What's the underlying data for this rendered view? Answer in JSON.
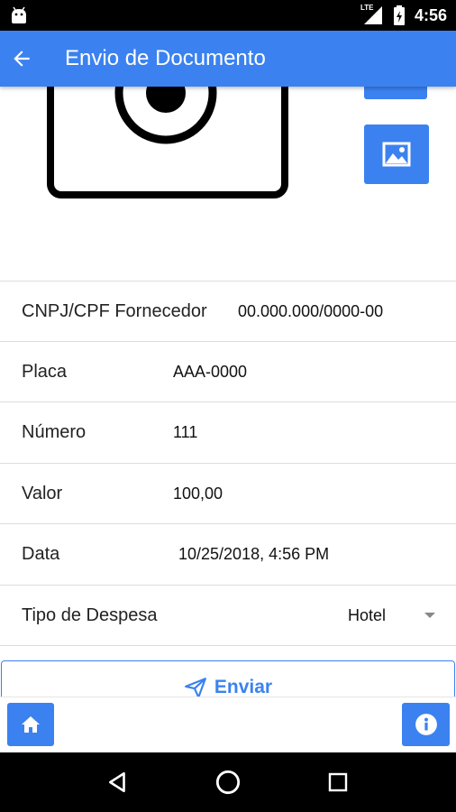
{
  "status_bar": {
    "time": "4:56",
    "network": "LTE",
    "icons": [
      "android-icon",
      "signal-icon",
      "battery-icon"
    ]
  },
  "app_bar": {
    "title": "Envio de Documento"
  },
  "form": {
    "fields": [
      {
        "label": "CNPJ/CPF Fornecedor",
        "value": "00.000.000/0000-00"
      },
      {
        "label": "Placa",
        "value": "AAA-0000"
      },
      {
        "label": "Número",
        "value": "111"
      },
      {
        "label": "Valor",
        "value": "100,00"
      },
      {
        "label": "Data",
        "value": "10/25/2018, 4:56 PM"
      },
      {
        "label": "Tipo de Despesa",
        "value": "Hotel"
      }
    ],
    "send_label": "Enviar"
  },
  "colors": {
    "accent": "#3b82f0",
    "status_bar": "#000000",
    "divider": "#dddddd"
  }
}
